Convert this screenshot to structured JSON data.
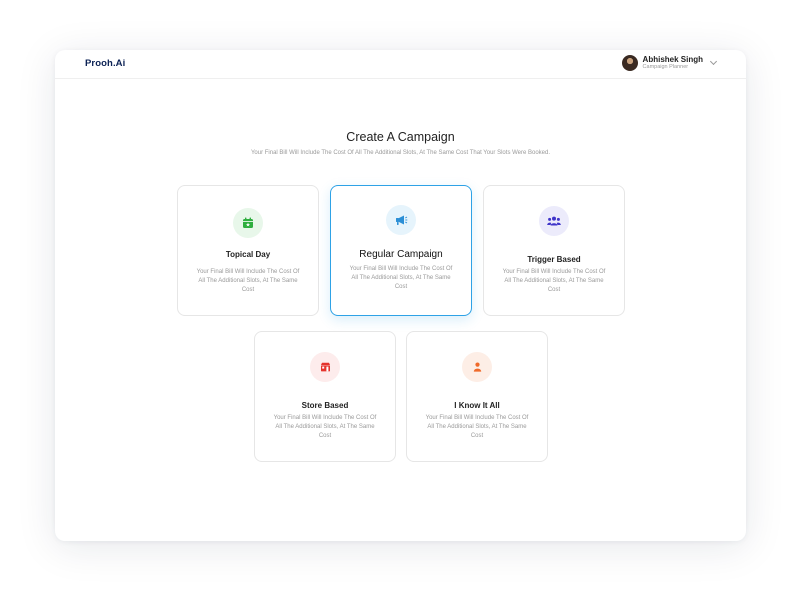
{
  "header": {
    "logo": "Prooh.Ai",
    "user_name": "Abhishek Singh",
    "user_role": "Campaign Planner"
  },
  "main": {
    "title": "Create A Campaign",
    "subtitle": "Your Final Bill Will Include The Cost Of All The Additional Slots, At The Same Cost That Your Slots Were Booked."
  },
  "cards": [
    {
      "title": "Topical Day",
      "description": "Your Final Bill Will Include The Cost Of All The Additional Slots, At The Same Cost",
      "icon": "calendar-icon",
      "icon_bg": "#e8f7ea",
      "icon_color": "#2fae3f",
      "selected": false
    },
    {
      "title": "Regular Campaign",
      "description": "Your Final Bill Will Include The Cost Of All The Additional Slots, At The Same Cost",
      "icon": "megaphone-icon",
      "icon_bg": "#e6f4fc",
      "icon_color": "#2b8fd6",
      "selected": true
    },
    {
      "title": "Trigger Based",
      "description": "Your Final Bill Will Include The Cost Of All The Additional Slots, At The Same Cost",
      "icon": "users-icon",
      "icon_bg": "#ecebfb",
      "icon_color": "#3f34c9",
      "selected": false
    },
    {
      "title": "Store Based",
      "description": "Your Final Bill Will Include The Cost Of All The Additional Slots, At The Same Cost",
      "icon": "store-icon",
      "icon_bg": "#fdecec",
      "icon_color": "#e5342d",
      "selected": false
    },
    {
      "title": "I Know It All",
      "description": "Your Final Bill Will Include The Cost Of All The Additional Slots, At The Same Cost",
      "icon": "person-icon",
      "icon_bg": "#fdeee6",
      "icon_color": "#f06a2a",
      "selected": false
    }
  ]
}
